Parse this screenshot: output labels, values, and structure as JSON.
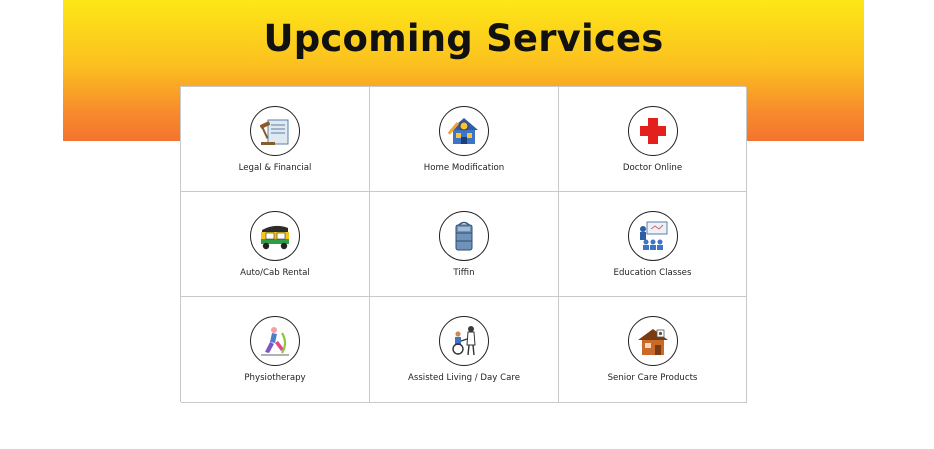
{
  "header": {
    "title": "Upcoming Services"
  },
  "colors": {
    "banner_top": "#fde716",
    "banner_bottom": "#f4742f",
    "grid_border": "#c9c9c9"
  },
  "services": [
    {
      "label": "Legal & Financial",
      "icon": "legal-financial-icon"
    },
    {
      "label": "Home Modification",
      "icon": "home-modification-icon"
    },
    {
      "label": "Doctor Online",
      "icon": "medical-cross-icon"
    },
    {
      "label": "Auto/Cab Rental",
      "icon": "auto-rickshaw-icon"
    },
    {
      "label": "Tiffin",
      "icon": "tiffin-box-icon"
    },
    {
      "label": "Education Classes",
      "icon": "classroom-icon"
    },
    {
      "label": "Physiotherapy",
      "icon": "physiotherapy-icon"
    },
    {
      "label": "Assisted Living / Day Care",
      "icon": "wheelchair-caregiver-icon"
    },
    {
      "label": "Senior Care Products",
      "icon": "senior-care-house-icon"
    }
  ]
}
